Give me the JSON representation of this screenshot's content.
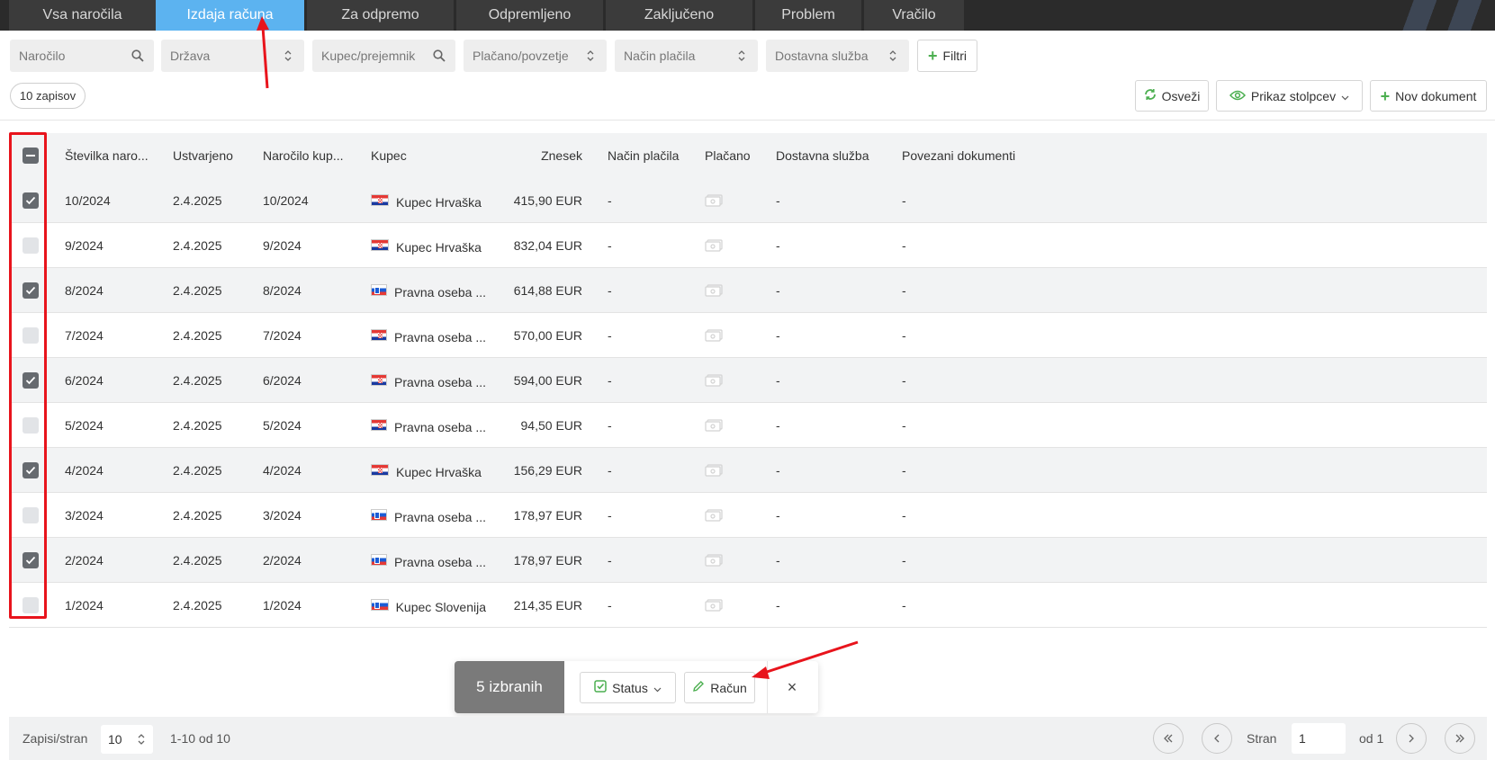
{
  "tabs": [
    {
      "label": "Vsa naročila",
      "active": false
    },
    {
      "label": "Izdaja računa",
      "active": true
    },
    {
      "label": "Za odpremo",
      "active": false
    },
    {
      "label": "Odpremljeno",
      "active": false
    },
    {
      "label": "Zaključeno",
      "active": false
    },
    {
      "label": "Problem",
      "active": false
    },
    {
      "label": "Vračilo",
      "active": false
    }
  ],
  "filters": {
    "order_placeholder": "Naročilo",
    "country": "Država",
    "customer_placeholder": "Kupec/prejemnik",
    "paid_cod": "Plačano/povzetje",
    "payment_method": "Način plačila",
    "delivery_service": "Dostavna služba",
    "filters_button": "Filtri"
  },
  "record_count": "10 zapisov",
  "toolbar": {
    "refresh": "Osveži",
    "columns": "Prikaz stolpcev",
    "new_document": "Nov dokument"
  },
  "table": {
    "headers": {
      "number": "Številka naro...",
      "created": "Ustvarjeno",
      "customer_order": "Naročilo kup...",
      "customer": "Kupec",
      "amount": "Znesek",
      "payment_method": "Način plačila",
      "paid": "Plačano",
      "delivery": "Dostavna služba",
      "related": "Povezani dokumenti"
    },
    "rows": [
      {
        "checked": true,
        "number": "10/2024",
        "created": "2.4.2025",
        "customer_order": "10/2024",
        "flag": "hr",
        "customer": "Kupec Hrvaška",
        "amount": "415,90 EUR",
        "payment_method": "-",
        "delivery": "-",
        "related": "-"
      },
      {
        "checked": false,
        "number": "9/2024",
        "created": "2.4.2025",
        "customer_order": "9/2024",
        "flag": "hr",
        "customer": "Kupec Hrvaška",
        "amount": "832,04 EUR",
        "payment_method": "-",
        "delivery": "-",
        "related": "-"
      },
      {
        "checked": true,
        "number": "8/2024",
        "created": "2.4.2025",
        "customer_order": "8/2024",
        "flag": "si",
        "customer": "Pravna oseba ...",
        "amount": "614,88 EUR",
        "payment_method": "-",
        "delivery": "-",
        "related": "-"
      },
      {
        "checked": false,
        "number": "7/2024",
        "created": "2.4.2025",
        "customer_order": "7/2024",
        "flag": "hr",
        "customer": "Pravna oseba ...",
        "amount": "570,00 EUR",
        "payment_method": "-",
        "delivery": "-",
        "related": "-"
      },
      {
        "checked": true,
        "number": "6/2024",
        "created": "2.4.2025",
        "customer_order": "6/2024",
        "flag": "hr",
        "customer": "Pravna oseba ...",
        "amount": "594,00 EUR",
        "payment_method": "-",
        "delivery": "-",
        "related": "-"
      },
      {
        "checked": false,
        "number": "5/2024",
        "created": "2.4.2025",
        "customer_order": "5/2024",
        "flag": "hr",
        "customer": "Pravna oseba ...",
        "amount": "94,50 EUR",
        "payment_method": "-",
        "delivery": "-",
        "related": "-"
      },
      {
        "checked": true,
        "number": "4/2024",
        "created": "2.4.2025",
        "customer_order": "4/2024",
        "flag": "hr",
        "customer": "Kupec Hrvaška",
        "amount": "156,29 EUR",
        "payment_method": "-",
        "delivery": "-",
        "related": "-"
      },
      {
        "checked": false,
        "number": "3/2024",
        "created": "2.4.2025",
        "customer_order": "3/2024",
        "flag": "si",
        "customer": "Pravna oseba ...",
        "amount": "178,97 EUR",
        "payment_method": "-",
        "delivery": "-",
        "related": "-"
      },
      {
        "checked": true,
        "number": "2/2024",
        "created": "2.4.2025",
        "customer_order": "2/2024",
        "flag": "si",
        "customer": "Pravna oseba ...",
        "amount": "178,97 EUR",
        "payment_method": "-",
        "delivery": "-",
        "related": "-"
      },
      {
        "checked": false,
        "number": "1/2024",
        "created": "2.4.2025",
        "customer_order": "1/2024",
        "flag": "si",
        "customer": "Kupec Slovenija",
        "amount": "214,35 EUR",
        "payment_method": "-",
        "delivery": "-",
        "related": "-"
      }
    ]
  },
  "bulk_bar": {
    "selected_count": "5 izbranih",
    "status_button": "Status",
    "invoice_button": "Račun",
    "close": "×"
  },
  "pagination": {
    "per_page_label": "Zapisi/stran",
    "per_page_value": "10",
    "range": "1-10 od 10",
    "page_label": "Stran",
    "page_value": "1",
    "of_pages": "od 1"
  },
  "colors": {
    "active_tab": "#5cb3f0",
    "tab_bg": "#3b3b3b",
    "accent_green": "#4caf50",
    "annotation_red": "#e8141c"
  }
}
